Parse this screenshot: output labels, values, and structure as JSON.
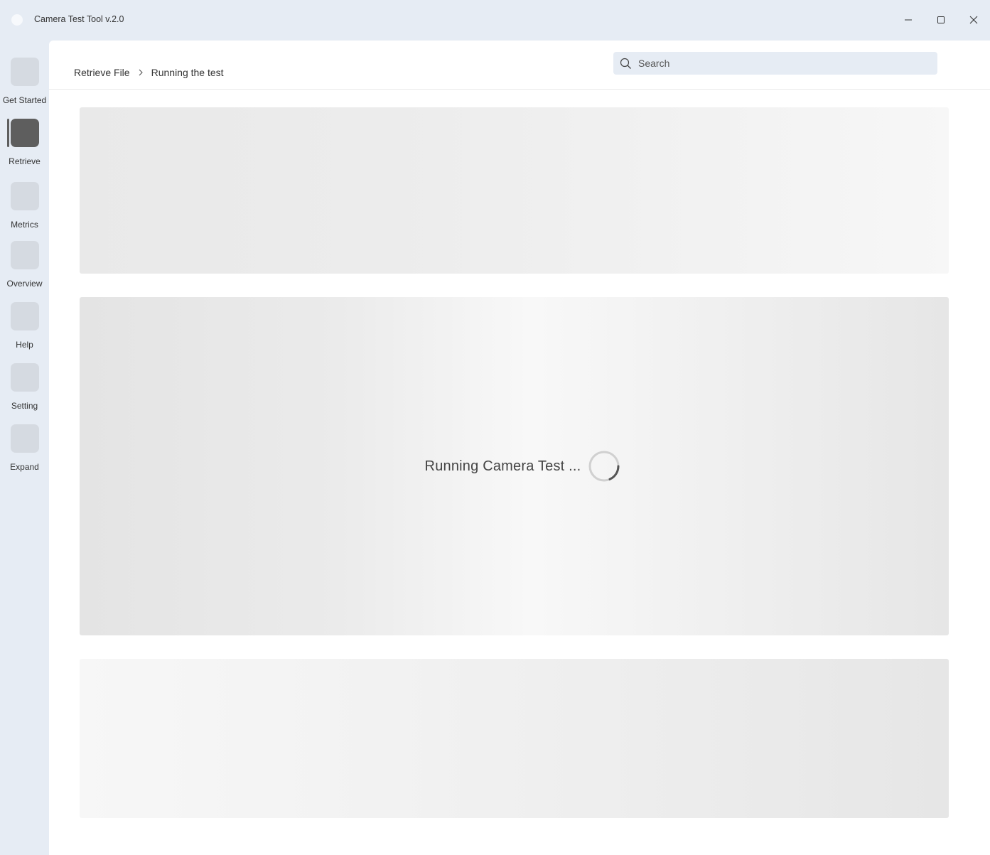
{
  "window": {
    "title": "Camera Test Tool v.2.0",
    "controls": [
      "minimize-icon",
      "maximize-icon",
      "close-icon"
    ]
  },
  "sidebar": {
    "items": [
      {
        "label": "Get Started",
        "icon": "get-started-icon",
        "active": false
      },
      {
        "label": "Retrieve",
        "icon": "retrieve-icon",
        "active": true
      },
      {
        "label": "Metrics",
        "icon": "metrics-icon",
        "active": false
      },
      {
        "label": "Overview",
        "icon": "overview-icon",
        "active": false
      },
      {
        "label": "Help",
        "icon": "help-icon",
        "active": false
      },
      {
        "label": "Setting",
        "icon": "setting-icon",
        "active": false
      },
      {
        "label": "Expand",
        "icon": "expand-icon",
        "active": false
      }
    ]
  },
  "breadcrumb": {
    "items": [
      "Retrieve File",
      "Running the test"
    ],
    "separator_icon": "chevron-right-icon"
  },
  "search": {
    "placeholder": "Search",
    "value": ""
  },
  "loading": {
    "text": "Running Camera Test ..."
  },
  "colors": {
    "chrome": "#e6ecf4",
    "placeholder_tile": "#d5dae1",
    "active_tile": "#5e5e5e",
    "content_bg": "#ffffff"
  }
}
